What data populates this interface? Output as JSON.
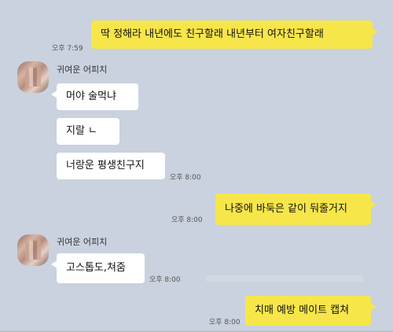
{
  "conversation": {
    "messages": [
      {
        "from": "me",
        "text": "딱 정해라 내년에도 친구할래 내년부터 여자친구할래",
        "time": "오후 7:59"
      },
      {
        "from": "other",
        "sender": "귀여운 어피치",
        "text": "머야 술먹냐"
      },
      {
        "from": "other",
        "text": "지랄 ㄴ"
      },
      {
        "from": "other",
        "text": "너랑운 평생친구지",
        "time": "오후 8:00"
      },
      {
        "from": "me",
        "text": "나중에 바둑은 같이 둬줄거지",
        "time": "오후 8:00"
      },
      {
        "from": "other",
        "sender": "귀여운 어피치",
        "text": "고스톱도,쳐줌",
        "time": "오후 8:00"
      },
      {
        "from": "me",
        "text": "치매 예방 메이트 캡쳐",
        "time": "오후 8:00"
      }
    ]
  },
  "colors": {
    "background": "#c9d2de",
    "my_bubble": "#f7e64a",
    "their_bubble": "#ffffff"
  }
}
